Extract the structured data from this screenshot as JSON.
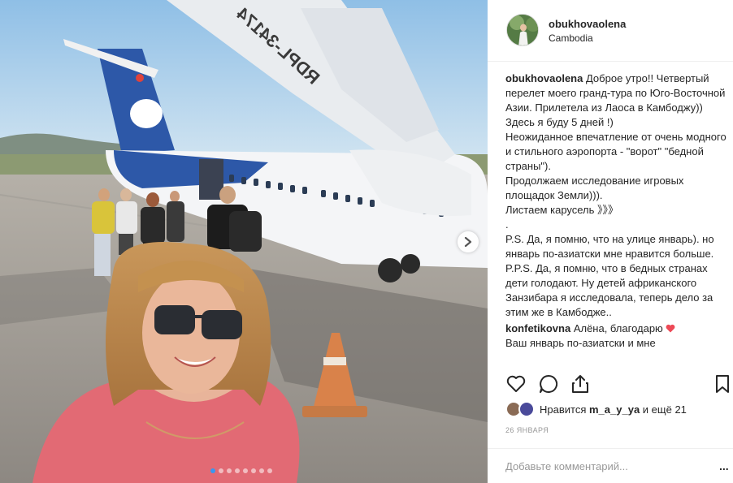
{
  "post": {
    "username": "obukhovaolena",
    "location": "Cambodia",
    "caption": "Доброе утро!! Четвертый перелет моего гранд-тура по Юго-Восточной Азии. Прилетела из Лаоса в Камбоджу))\nЗдесь я буду 5 дней !)\nНеожиданное впечатление от очень модного и стильного аэропорта - \"ворот\" \"бедной страны\").\nПродолжаем исследование игровых площадок Земли))).\nЛистаем карусель 》》》\n.\nP.S. Да, я помню, что на улице январь). но январь по-азиатски мне нравится больше.\nP.P.S. Да, я помню, что в бедных странах дети голодают. Ну детей африканского Занзибара я исследовала, теперь дело за этим же в Камбодже..",
    "photo_aircraft_reg": "RDPL-34174"
  },
  "comments": [
    {
      "author": "konfetikovna",
      "text": "Алёна, благодарю",
      "text2": "Ваш январь по-азиатски и мне"
    }
  ],
  "likes": {
    "prefix": "Нравится",
    "user": "m_a_y_ya",
    "suffix": "и ещё 21"
  },
  "date": "26 ЯНВАРЯ",
  "add_comment": {
    "placeholder": "Добавьте комментарий..."
  },
  "more_label": "...",
  "carousel": {
    "total_slides": 8,
    "active_index": 0
  },
  "colors": {
    "accent": "#3897f0",
    "heart": "#ed4956",
    "text": "#262626",
    "muted": "#999999"
  },
  "icons": [
    "heart-icon",
    "comment-icon",
    "share-icon",
    "bookmark-icon",
    "chevron-right-icon"
  ]
}
